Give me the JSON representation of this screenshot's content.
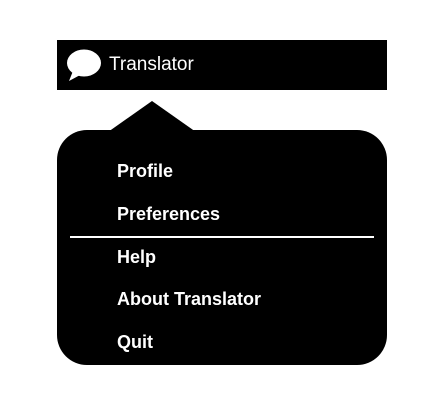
{
  "titlebar": {
    "title": "Translator",
    "icon": "speech-bubble-icon"
  },
  "menu": {
    "items": [
      {
        "label": "Profile"
      },
      {
        "label": "Preferences"
      },
      {
        "label": "Help"
      },
      {
        "label": "About Translator"
      },
      {
        "label": "Quit"
      }
    ]
  },
  "colors": {
    "background": "#ffffff",
    "menu_background": "#000000",
    "text": "#ffffff"
  }
}
